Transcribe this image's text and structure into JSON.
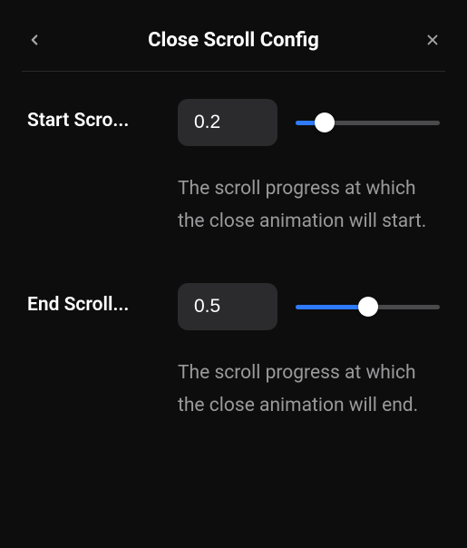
{
  "header": {
    "title": "Close Scroll Config"
  },
  "fields": {
    "start": {
      "label": "Start Scro...",
      "value": "0.2",
      "slider_percent": 20,
      "description": "The scroll progress at which the close animation will start."
    },
    "end": {
      "label": "End Scroll...",
      "value": "0.5",
      "slider_percent": 50,
      "description": "The scroll progress at which the close animation will end."
    }
  },
  "colors": {
    "accent": "#2f7bff",
    "bg": "#0d0d0d",
    "input_bg": "#2b2b2d",
    "track": "#4a4a4d",
    "text_muted": "#9a9a9c"
  }
}
